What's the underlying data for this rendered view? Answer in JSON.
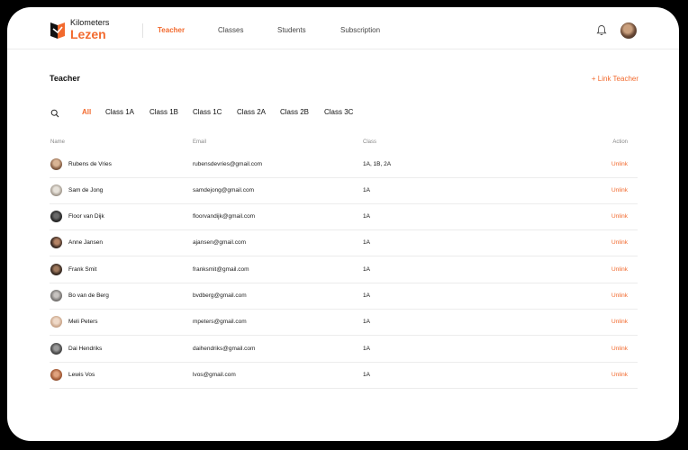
{
  "brand": {
    "line1": "Kilometers",
    "line2": "Lezen",
    "accent": "#f26a2e"
  },
  "nav": [
    {
      "label": "Teacher",
      "active": true
    },
    {
      "label": "Classes",
      "active": false
    },
    {
      "label": "Students",
      "active": false
    },
    {
      "label": "Subscription",
      "active": false
    }
  ],
  "page": {
    "title": "Teacher",
    "link_button": "+ Link Teacher"
  },
  "filters": [
    {
      "label": "All",
      "active": true
    },
    {
      "label": "Class 1A",
      "active": false
    },
    {
      "label": "Class 1B",
      "active": false
    },
    {
      "label": "Class 1C",
      "active": false
    },
    {
      "label": "Class 2A",
      "active": false
    },
    {
      "label": "Class 2B",
      "active": false
    },
    {
      "label": "Class 3C",
      "active": false
    }
  ],
  "table": {
    "headers": {
      "name": "Name",
      "email": "Email",
      "class": "Class",
      "action": "Action"
    },
    "rows": [
      {
        "name": "Rubens de Vries",
        "email": "rubensdevries@gmail.com",
        "class": "1A, 1B, 2A",
        "action": "Unlink"
      },
      {
        "name": "Sam de Jong",
        "email": "samdejong@gmail.com",
        "class": "1A",
        "action": "Unlink"
      },
      {
        "name": "Floor van Dijk",
        "email": "floorvandijk@gmail.com",
        "class": "1A",
        "action": "Unlink"
      },
      {
        "name": "Anne Jansen",
        "email": "ajansen@gmail.com",
        "class": "1A",
        "action": "Unlink"
      },
      {
        "name": "Frank Smit",
        "email": "franksmit@gmail.com",
        "class": "1A",
        "action": "Unlink"
      },
      {
        "name": "Bo van de Berg",
        "email": "bvdberg@gmail.com",
        "class": "1A",
        "action": "Unlink"
      },
      {
        "name": "Meli Peters",
        "email": "mpeters@gmail.com",
        "class": "1A",
        "action": "Unlink"
      },
      {
        "name": "Dai Hendriks",
        "email": "daihendriks@gmail.com",
        "class": "1A",
        "action": "Unlink"
      },
      {
        "name": "Lewis Vos",
        "email": "lvos@gmail.com",
        "class": "1A",
        "action": "Unlink"
      }
    ]
  }
}
